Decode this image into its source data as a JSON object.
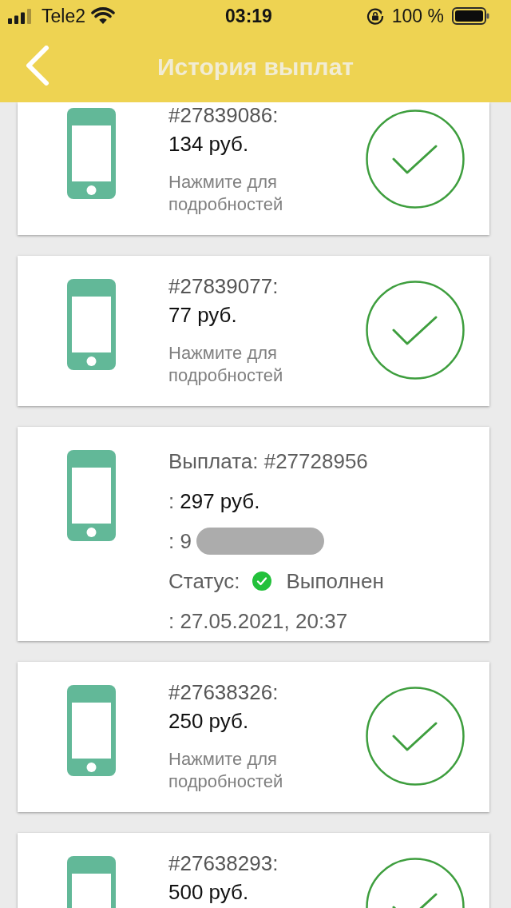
{
  "status_bar": {
    "carrier": "Tele2",
    "time": "03:19",
    "battery": "100 %"
  },
  "header": {
    "title": "История выплат"
  },
  "payouts": [
    {
      "kind": "summary",
      "number": "#27839086:",
      "amount": "134 руб.",
      "hint": "Нажмите для подробностей",
      "completed": true
    },
    {
      "kind": "summary",
      "number": "#27839077:",
      "amount": "77 руб.",
      "hint": "Нажмите для подробностей",
      "completed": true
    },
    {
      "kind": "details",
      "lines": [
        {
          "kind": "text",
          "text": "Выплата: #27728956"
        },
        {
          "kind": "value",
          "label": ":",
          "value": "297 руб."
        },
        {
          "kind": "redacted",
          "label": ": 9"
        },
        {
          "kind": "status",
          "label": "Статус:",
          "completed": true,
          "value": "Выполнен"
        },
        {
          "kind": "text",
          "text": ": 27.05.2021, 20:37"
        }
      ]
    },
    {
      "kind": "summary",
      "number": "#27638326:",
      "amount": "250 руб.",
      "hint": "Нажмите для подробностей",
      "completed": true
    },
    {
      "kind": "summary",
      "number": "#27638293:",
      "amount": "500 руб.",
      "completed": true
    }
  ]
}
